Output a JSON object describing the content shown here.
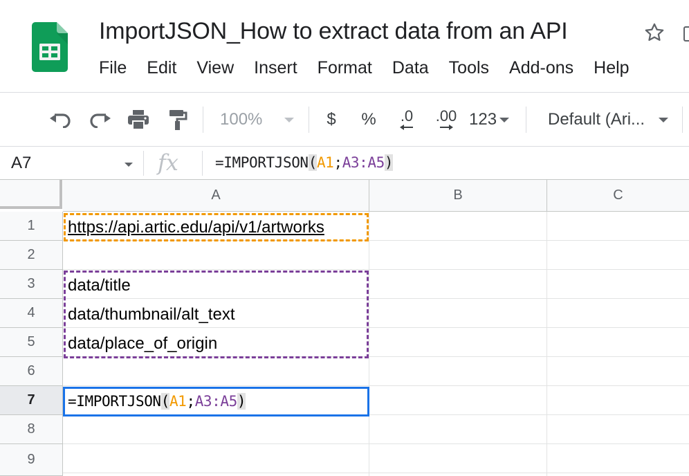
{
  "document": {
    "title": "ImportJSON_How to extract data from an API",
    "star_icon": "star-icon",
    "move_icon": "move-to-folder-icon",
    "logo_icon": "google-sheets-logo-icon"
  },
  "menu": [
    "File",
    "Edit",
    "View",
    "Insert",
    "Format",
    "Data",
    "Tools",
    "Add-ons",
    "Help"
  ],
  "toolbar": {
    "undo_icon": "undo-icon",
    "redo_icon": "redo-icon",
    "print_icon": "print-icon",
    "paint_format_icon": "paint-format-icon",
    "zoom": "100%",
    "currency": "$",
    "percent": "%",
    "decrease_decimal": ".0",
    "increase_decimal": ".00",
    "more_formats": "123",
    "font": "Default (Ari..."
  },
  "formula_bar": {
    "name_box": "A7",
    "fx_label": "fx",
    "formula_prefix": "=IMPORTJSON",
    "open_paren": "(",
    "arg1": "A1",
    "separator": ";",
    "arg2": "A3:A5",
    "close_paren": ")"
  },
  "grid": {
    "columns": [
      "A",
      "B",
      "C"
    ],
    "rows": [
      "1",
      "2",
      "3",
      "4",
      "5",
      "6",
      "7",
      "8",
      "9"
    ],
    "active_row": "7",
    "cells": {
      "A1": "https://api.artic.edu/api/v1/artworks",
      "A3": "data/title",
      "A4": "data/thumbnail/alt_text",
      "A5": "data/place_of_origin"
    },
    "a7": {
      "prefix": "=IMPORTJSON",
      "open_paren": "(",
      "arg1": "A1",
      "separator": ";",
      "arg2": "A3:A5",
      "close_paren": ")"
    }
  },
  "colors": {
    "accent_blue": "#1a73e8",
    "ref_orange": "#f29900",
    "ref_purple": "#7b3f99",
    "sheets_green": "#0f9d58"
  }
}
